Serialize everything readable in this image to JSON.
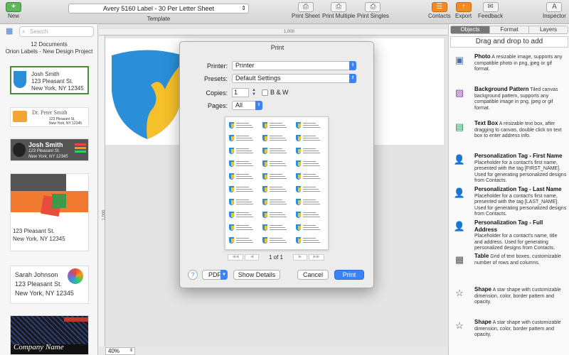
{
  "toolbar": {
    "new_label": "New",
    "template_value": "Avery 5160 Label - 30 Per Letter Sheet",
    "template_label": "Template",
    "print_sheet": "Print Sheet",
    "print_multiple": "Print Multiple",
    "print_singles": "Print Singles",
    "contacts": "Contacts",
    "export": "Export",
    "feedback": "Feedback",
    "inspector": "Inspector",
    "icons": {
      "new": "+",
      "print": "⎙",
      "contacts": "☰",
      "export": "↑",
      "feedback": "✉",
      "inspector": "A"
    }
  },
  "sidebar": {
    "search_placeholder": "Search",
    "doc_count": "12 Documents",
    "project": "Orion Labels - New Design Project",
    "thumbs": [
      {
        "lines": [
          "Josh Smith",
          "123 Pleasant St.",
          "New York, NY 12345"
        ]
      },
      {
        "lines": [
          "Dr. Peter Smith",
          "123 Pleasant St.",
          "New York, NY 12345"
        ]
      },
      {
        "lines": [
          "Josh Smith",
          "123 Pleasant St.",
          "New York, NY 12345"
        ]
      },
      {
        "lines": [
          "123 Pleasant St.",
          "New York, NY 12345"
        ]
      },
      {
        "lines": [
          "Sarah Johnson",
          "123 Pleasant St.",
          "New York, NY 12345"
        ]
      },
      {
        "lines": [
          "Company Name"
        ]
      }
    ]
  },
  "canvas": {
    "ruler_mark": "1,000",
    "ruler_v_mark": "1,000",
    "zoom": "40%",
    "colors": {
      "shield_blue": "#2a8fd8",
      "shield_yellow": "#f6c02a"
    }
  },
  "inspector_panel": {
    "tabs": [
      "Objects",
      "Format",
      "Layers"
    ],
    "drag_hint": "Drag and drop to add",
    "objects": [
      {
        "icon": "photo-icon",
        "glyph": "▣",
        "title": "Photo",
        "desc": "A resizable image, supports any compatible photo in png, jpeg or gif format."
      },
      {
        "icon": "pattern-icon",
        "glyph": "▨",
        "title": "Background Pattern",
        "desc": "Tiled canvas background pattern, supports any compatible image in png, jpeg or gif format."
      },
      {
        "icon": "textbox-icon",
        "glyph": "▤",
        "title": "Text Box",
        "desc": "A resizable text box, after dragging to canvas, double click on text box to enter address info."
      },
      {
        "icon": "person-icon",
        "glyph": "👤",
        "title": "Personalization Tag - First Name",
        "desc": "Placeholder for a contact's first name, presented with the tag [FIRST_NAME]. Used for generating personalized designs from Contacts."
      },
      {
        "icon": "person-icon",
        "glyph": "👤",
        "title": "Personalization Tag - Last Name",
        "desc": "Placeholder for a contact's first name, presented with the tag [LAST_NAME]. Used for generating personalized designs from Contacts."
      },
      {
        "icon": "person-icon",
        "glyph": "👤",
        "title": "Personalization Tag - Full Address",
        "desc": "Placeholder for a contact's name, title and address. Used for generating personalized designs from Contacts."
      },
      {
        "icon": "table-icon",
        "glyph": "▦",
        "title": "Table",
        "desc": "Grid of text boxes, customizable number of rows and columns."
      },
      {
        "icon": "star-icon",
        "glyph": "☆",
        "title": "Shape",
        "desc": "A star shape with customizable dimension, color, border pattern and opacity."
      },
      {
        "icon": "star-icon",
        "glyph": "☆",
        "title": "Shape",
        "desc": "A star shape with customizable dimension, color, border pattern and opacity."
      }
    ]
  },
  "print_dialog": {
    "title": "Print",
    "printer_label": "Printer:",
    "printer_value": "Printer",
    "presets_label": "Presets:",
    "presets_value": "Default Settings",
    "copies_label": "Copies:",
    "copies_value": "1",
    "bw_label": "B & W",
    "pages_label": "Pages:",
    "pages_value": "All",
    "page_of": "1 of 1",
    "pager_first": "◀◀",
    "pager_prev": "◀",
    "pager_next": "▶",
    "pager_last": "▶▶",
    "help": "?",
    "pdf": "PDF",
    "show_details": "Show Details",
    "cancel": "Cancel",
    "print": "Print"
  }
}
